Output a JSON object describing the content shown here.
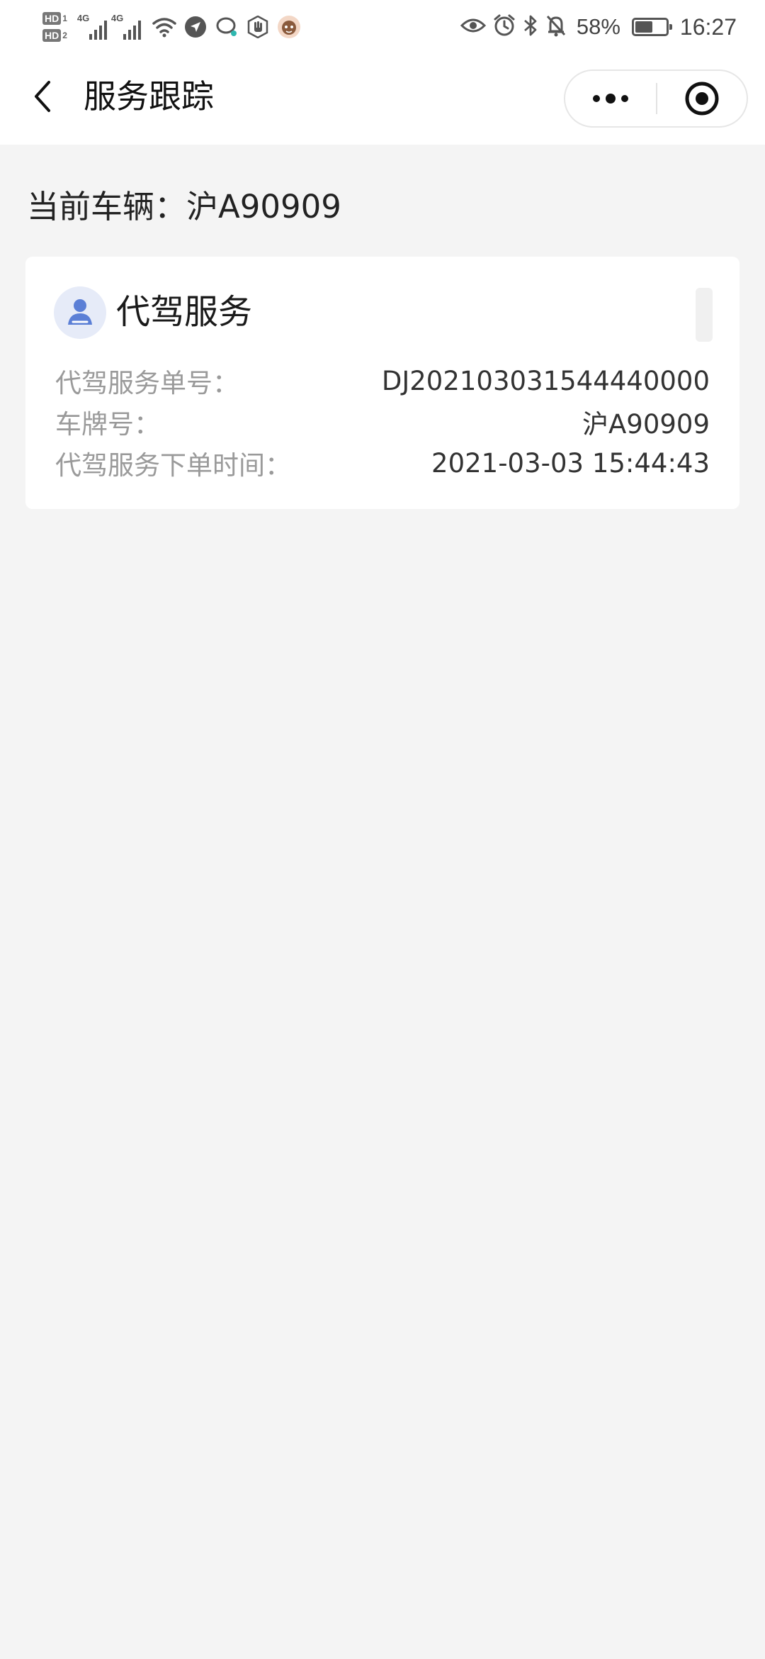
{
  "status_bar": {
    "hd1": "HD",
    "hd1_sub": "1",
    "hd2": "HD",
    "hd2_sub": "2",
    "net1": "4G",
    "net2": "4G",
    "battery_percent": "58%",
    "battery_level": 0.58,
    "time": "16:27",
    "icons": [
      "wifi-icon",
      "location-icon",
      "chat-bubble-icon",
      "hand-icon",
      "avatar-app-icon",
      "eye-icon",
      "alarm-icon",
      "bluetooth-icon",
      "mute-bell-icon"
    ]
  },
  "nav": {
    "title": "服务跟踪",
    "back_icon": "chevron-left-icon",
    "more_icon": "more-dots-icon",
    "close_icon": "target-circle-icon"
  },
  "vehicle": {
    "line": "当前车辆：沪A90909"
  },
  "service_card": {
    "title": "代驾服务",
    "icon": "driver-person-icon",
    "rows": [
      {
        "label": "代驾服务单号：",
        "value": "DJ202103031544440000"
      },
      {
        "label": "车牌号：",
        "value": "沪A90909"
      },
      {
        "label": "代驾服务下单时间：",
        "value": "2021-03-03 15:44:43"
      }
    ]
  },
  "colors": {
    "page_bg": "#f4f4f4",
    "card_bg": "#ffffff",
    "label_text": "#9a9a9a",
    "value_text": "#333333",
    "avatar_bg": "#e6ebf8",
    "avatar_fg": "#5b7fd6"
  }
}
